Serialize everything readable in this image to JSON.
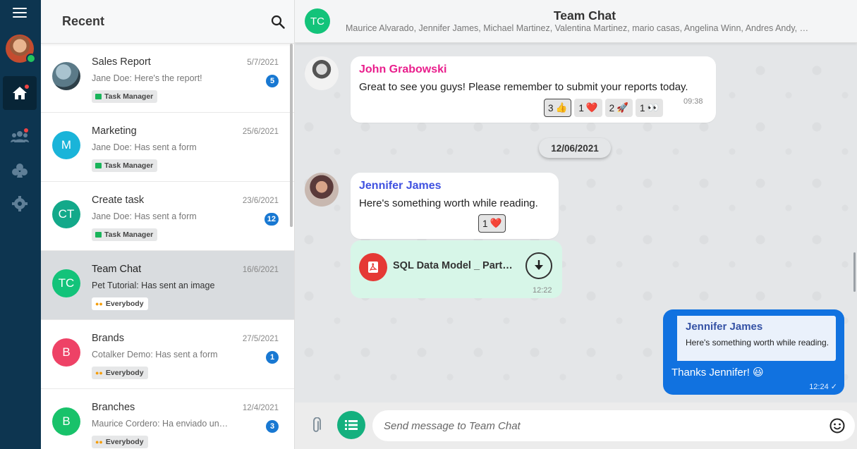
{
  "sidebar": {
    "icons": [
      "menu-icon",
      "home-icon",
      "contacts-icon",
      "clubs-icon",
      "settings-icon"
    ],
    "user_status": "online"
  },
  "chat_list": {
    "title": "Recent",
    "items": [
      {
        "name": "Sales Report",
        "date": "5/7/2021",
        "preview": "Jane Doe: Here's the report!",
        "badge": "5",
        "tag": "Task Manager",
        "tag_type": "task",
        "avatar": "",
        "avatar_color": "#4b6b7a"
      },
      {
        "name": "Marketing",
        "date": "25/6/2021",
        "preview": "Jane Doe: Has sent a form",
        "badge": "",
        "tag": "Task Manager",
        "tag_type": "task",
        "avatar": "M",
        "avatar_color": "#1ab4d9"
      },
      {
        "name": "Create task",
        "date": "23/6/2021",
        "preview": "Jane Doe: Has sent a form",
        "badge": "12",
        "tag": "Task Manager",
        "tag_type": "task",
        "avatar": "CT",
        "avatar_color": "#13a98a"
      },
      {
        "name": "Team Chat",
        "date": "16/6/2021",
        "preview": "Pet Tutorial: Has sent an image",
        "badge": "",
        "tag": "Everybody",
        "tag_type": "people",
        "avatar": "TC",
        "avatar_color": "#13c37a"
      },
      {
        "name": "Brands",
        "date": "27/5/2021",
        "preview": "Cotalker Demo: Has sent a form",
        "badge": "1",
        "tag": "Everybody",
        "tag_type": "people",
        "avatar": "B",
        "avatar_color": "#ee4266"
      },
      {
        "name": "Branches",
        "date": "12/4/2021",
        "preview": "Maurice Cordero: Ha enviado un formulario",
        "badge": "3",
        "tag": "Everybody",
        "tag_type": "people",
        "avatar": "B",
        "avatar_color": "#18c26a"
      }
    ]
  },
  "conversation": {
    "avatar": "TC",
    "title": "Team Chat",
    "members": "Maurice Alvarado, Jennifer James, Michael Martinez, Valentina Martinez, mario casas, Angelina Winn, Andres Andy, …",
    "messages": [
      {
        "sender": "John Grabowski",
        "sender_color": "#e91e8c",
        "text": "Great to see you guys! Please remember to submit your reports today.",
        "time": "09:38",
        "reactions": [
          {
            "count": "3",
            "emoji": "👍"
          },
          {
            "count": "1",
            "emoji": "❤️"
          },
          {
            "count": "2",
            "emoji": "🚀"
          },
          {
            "count": "1",
            "emoji": "👀"
          }
        ]
      },
      {
        "sender": "Jennifer James",
        "sender_color": "#3f51e0",
        "text": "Here's something worth while reading.",
        "reactions": [
          {
            "count": "1",
            "emoji": "❤️"
          }
        ]
      }
    ],
    "date_separator": "12/06/2021",
    "file": {
      "name": "SQL Data Model _ Part…",
      "time": "12:22"
    },
    "outgoing": {
      "quote_name": "Jennifer James",
      "quote_text": "Here's something worth while reading.",
      "text": "Thanks Jennifer! 😃",
      "time": "12:24 ✓"
    }
  },
  "composer": {
    "placeholder": "Send message to Team Chat"
  }
}
